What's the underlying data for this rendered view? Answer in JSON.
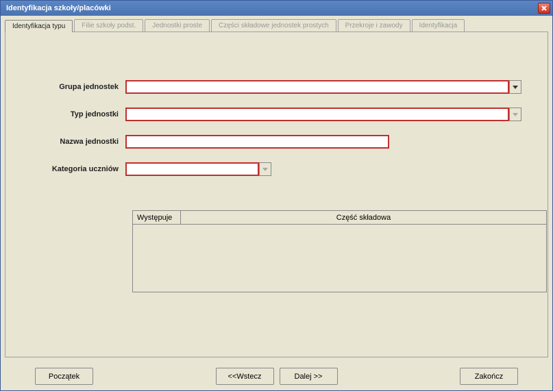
{
  "window": {
    "title": "Identyfikacja szkoły/placówki"
  },
  "tabs": [
    {
      "label": "Identyfikacja typu"
    },
    {
      "label": "Filie szkoły podst."
    },
    {
      "label": "Jednostki proste"
    },
    {
      "label": "Części składowe jednostek prostych"
    },
    {
      "label": "Przekroje i zawody"
    },
    {
      "label": "Identyfikacja"
    }
  ],
  "form": {
    "grupa_label": "Grupa jednostek",
    "grupa_value": "",
    "typ_label": "Typ jednostki",
    "typ_value": "",
    "nazwa_label": "Nazwa jednostki",
    "nazwa_value": "",
    "kategoria_label": "Kategoria uczniów",
    "kategoria_value": ""
  },
  "table": {
    "col1": "Występuje",
    "col2": "Część składowa"
  },
  "buttons": {
    "start": "Początek",
    "back": "<<Wstecz",
    "next": "Dalej >>",
    "finish": "Zakończ"
  }
}
